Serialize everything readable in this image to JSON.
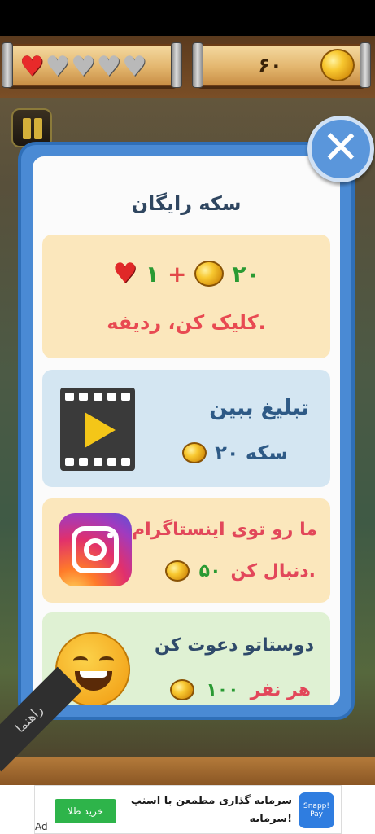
{
  "hud": {
    "hearts": [
      "full",
      "empty",
      "empty",
      "empty",
      "empty"
    ],
    "coins": "۶۰"
  },
  "dialog": {
    "title": "سکه رایگان",
    "close_icon": "close-icon",
    "cards": [
      {
        "id": "retry",
        "coins": "۲۰",
        "plus": "+",
        "hearts": "۱",
        "text": "کلیک کن، ردیفه."
      },
      {
        "id": "watch-ad",
        "title": "تبلیغ ببین",
        "reward": "۲۰ سکه",
        "icon": "film-play-icon"
      },
      {
        "id": "instagram",
        "title": "ما رو توی اینستاگرام",
        "subtitle": "دنبال کن.",
        "reward": "۵۰",
        "icon": "instagram-icon"
      },
      {
        "id": "invite",
        "title": "دوستاتو دعوت کن",
        "subtitle": "هر نفر",
        "reward": "۱۰۰",
        "icon": "smiley-icon"
      }
    ]
  },
  "guide": {
    "label": "راهنما"
  },
  "ad": {
    "button": "خرید طلا",
    "text": "سرمایه گذاری مطمعن با اسنپ سرمایه!",
    "logo": "Snapp! Pay",
    "label": "Ad"
  }
}
